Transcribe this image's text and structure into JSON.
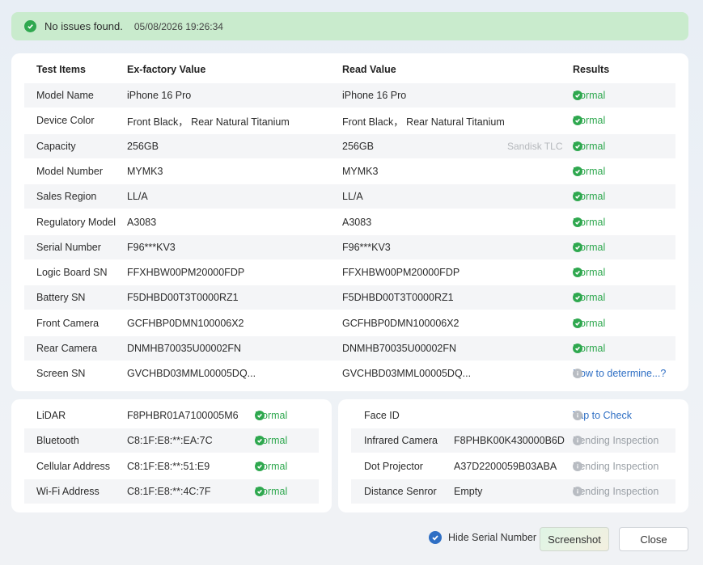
{
  "banner": {
    "message": "No issues found.",
    "timestamp": "05/08/2026 19:26:34"
  },
  "table": {
    "headers": {
      "item": "Test Items",
      "factory": "Ex-factory Value",
      "read": "Read Value",
      "result": "Results"
    },
    "rows": [
      {
        "item": "Model Name",
        "factory": "iPhone 16 Pro",
        "read": "iPhone 16 Pro",
        "note": "",
        "result": "Normal",
        "state": "ok"
      },
      {
        "item": "Device Color",
        "factory": "Front Black， Rear Natural Titanium",
        "read": "Front Black， Rear Natural Titanium",
        "note": "",
        "result": "Normal",
        "state": "ok"
      },
      {
        "item": "Capacity",
        "factory": "256GB",
        "read": "256GB",
        "note": "Sandisk TLC",
        "result": "Normal",
        "state": "ok"
      },
      {
        "item": "Model Number",
        "factory": "MYMK3",
        "read": "MYMK3",
        "note": "",
        "result": "Normal",
        "state": "ok"
      },
      {
        "item": "Sales Region",
        "factory": "LL/A",
        "read": "LL/A",
        "note": "",
        "result": "Normal",
        "state": "ok"
      },
      {
        "item": "Regulatory Model",
        "factory": "A3083",
        "read": "A3083",
        "note": "",
        "result": "Normal",
        "state": "ok"
      },
      {
        "item": "Serial Number",
        "factory": "F96***KV3",
        "read": "F96***KV3",
        "note": "",
        "result": "Normal",
        "state": "ok"
      },
      {
        "item": "Logic Board SN",
        "factory": "FFXHBW00PM20000FDP",
        "read": "FFXHBW00PM20000FDP",
        "note": "",
        "result": "Normal",
        "state": "ok"
      },
      {
        "item": "Battery SN",
        "factory": "F5DHBD00T3T0000RZ1",
        "read": "F5DHBD00T3T0000RZ1",
        "note": "",
        "result": "Normal",
        "state": "ok"
      },
      {
        "item": "Front Camera",
        "factory": "GCFHBP0DMN100006X2",
        "read": "GCFHBP0DMN100006X2",
        "note": "",
        "result": "Normal",
        "state": "ok"
      },
      {
        "item": "Rear Camera",
        "factory": "DNMHB70035U00002FN",
        "read": "DNMHB70035U00002FN",
        "note": "",
        "result": "Normal",
        "state": "ok"
      },
      {
        "item": "Screen SN",
        "factory": "GVCHBD03MML00005DQ...",
        "read": "GVCHBD03MML00005DQ...",
        "note": "",
        "result": "How to determine...?",
        "state": "link"
      }
    ]
  },
  "left_panel": [
    {
      "item": "LiDAR",
      "value": "F8PHBR01A7100005M6",
      "result": "Normal"
    },
    {
      "item": "Bluetooth",
      "value": "C8:1F:E8:**:EA:7C",
      "result": "Normal"
    },
    {
      "item": "Cellular Address",
      "value": "C8:1F:E8:**:51:E9",
      "result": "Normal"
    },
    {
      "item": "Wi-Fi Address",
      "value": "C8:1F:E8:**:4C:7F",
      "result": "Normal"
    }
  ],
  "right_panel": [
    {
      "item": "Face ID",
      "value": "",
      "result": "Tap to Check",
      "state": "link"
    },
    {
      "item": "Infrared Camera",
      "value": "F8PHBK00K430000B6D",
      "result": "Pending Inspection",
      "state": "pending"
    },
    {
      "item": "Dot Projector",
      "value": "A37D2200059B03ABA",
      "result": "Pending Inspection",
      "state": "pending"
    },
    {
      "item": "Distance Senror",
      "value": "Empty",
      "result": "Pending Inspection",
      "state": "pending"
    }
  ],
  "footer": {
    "hide_serial_label": "Hide Serial Number",
    "screenshot_label": "Screenshot",
    "close_label": "Close"
  },
  "colors": {
    "normal": "#2fa84f",
    "link": "#2f6fc4",
    "pending": "#9aa0a6",
    "banner_bg": "#c9ebcd"
  },
  "icons": {
    "ok": "check-circle-icon",
    "info": "info-circle-icon",
    "checkbox": "checkbox-checked-icon"
  }
}
